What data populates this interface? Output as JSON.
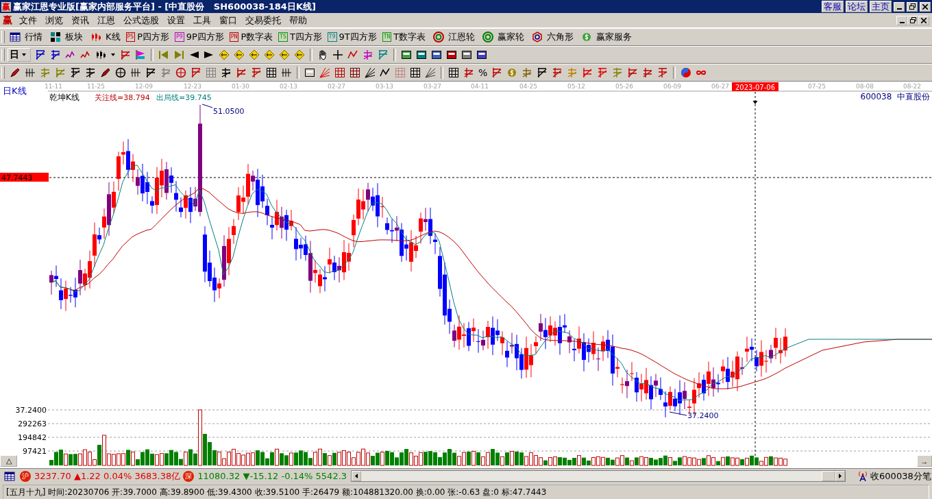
{
  "window": {
    "logo": "赢",
    "title": "赢家江恩专业版[赢家内部服务平台] - [中直股份   SH600038-184日K线]",
    "links": [
      "客服",
      "论坛",
      "主页"
    ]
  },
  "menu": {
    "logo": "赢",
    "items": [
      "文件",
      "浏览",
      "资讯",
      "江恩",
      "公式选股",
      "设置",
      "工具",
      "窗口",
      "交易委托",
      "帮助"
    ]
  },
  "toolbar": [
    {
      "label": "行情"
    },
    {
      "label": "板块"
    },
    {
      "label": "K线"
    },
    {
      "badge": "PS",
      "label": "P四方形",
      "color": "#c00000"
    },
    {
      "badge": "P9",
      "label": "9P四方形",
      "color": "#c000c0"
    },
    {
      "badge": "PN",
      "label": "P数字表",
      "color": "#c00000"
    },
    {
      "badge": "TS",
      "label": "T四方形",
      "color": "#00a000"
    },
    {
      "badge": "T9",
      "label": "9T四方形",
      "color": "#008080"
    },
    {
      "badge": "TN",
      "label": "T数字表",
      "color": "#00a000"
    },
    {
      "label": "江恩轮"
    },
    {
      "label": "赢家轮"
    },
    {
      "label": "六角形"
    },
    {
      "label": "赢家服务"
    }
  ],
  "period_selector": "日",
  "toolbar_percent": "%",
  "chart": {
    "period_label": "日K线",
    "indicator_name": "乾坤K线",
    "watch_line": "关注线=38.794",
    "exit_line": "出局线=39.745",
    "stock": "600038  中直股份",
    "dates": [
      "11-11",
      "11-25",
      "12-09",
      "12-23",
      "01-30",
      "02-13",
      "02-27",
      "03-13",
      "03-27",
      "04-11",
      "04-25",
      "05-12",
      "05-26",
      "06-09",
      "06-27",
      "07-25",
      "08-08",
      "08-22"
    ],
    "cursor_date": "2023-07-06",
    "cursor_price": "47.7443",
    "high_label": "51.0500",
    "low_label": "37.2400",
    "axis_labels": [
      "37.2400",
      "292263",
      "194842",
      "97421"
    ],
    "collapse_button": "△",
    "next_button": "→"
  },
  "index_bar": {
    "indexes": [
      {
        "badge": "沪",
        "value": "3237.70",
        "change": "▲1.22",
        "percent": "0.04%",
        "turnover": "3683.38亿",
        "color": "#e00000"
      },
      {
        "badge": "深",
        "value": "11080.32",
        "change": "▼-15.12",
        "percent": "-0.14%",
        "turnover": "5542.3",
        "color": "#008000"
      }
    ],
    "tick_label": "收600038分笔"
  },
  "info_bar": "[五月十九] 时间:20230706 开:39.7000 高:39.8900 低:39.4300 收:39.5100 手:26479 额:104881320.00 换:0.00 张:-0.63 盘:0 标:47.7443"
}
